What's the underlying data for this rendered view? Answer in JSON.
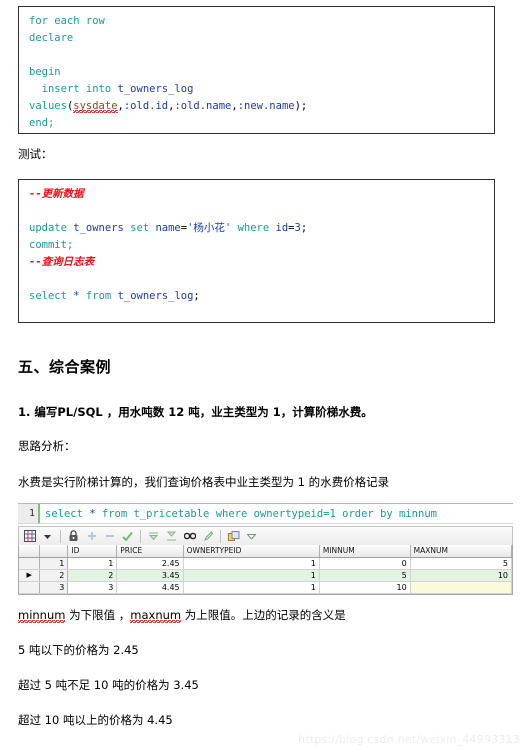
{
  "code_block_1": {
    "name": "trigger-body-code",
    "lines": [
      [
        {
          "t": "for each row",
          "c": "kw"
        }
      ],
      [
        {
          "t": "declare",
          "c": "kw"
        }
      ],
      [
        {
          "t": "",
          "c": "plain"
        }
      ],
      [
        {
          "t": "begin",
          "c": "kw"
        }
      ],
      [
        {
          "t": "  ",
          "c": "plain"
        },
        {
          "t": "insert into",
          "c": "kw"
        },
        {
          "t": " ",
          "c": "plain"
        },
        {
          "t": "t_owners_log",
          "c": "tbl"
        }
      ],
      [
        {
          "t": "values",
          "c": "fn"
        },
        {
          "t": "(",
          "c": "plain"
        },
        {
          "t": "sysdate",
          "c": "sq"
        },
        {
          "t": ",",
          "c": "plain"
        },
        {
          "t": ":old.id",
          "c": "bind"
        },
        {
          "t": ",",
          "c": "plain"
        },
        {
          "t": ":old.name",
          "c": "bind"
        },
        {
          "t": ",",
          "c": "plain"
        },
        {
          "t": ":new.name",
          "c": "bind"
        },
        {
          "t": ");",
          "c": "plain"
        }
      ],
      [
        {
          "t": "end;",
          "c": "kw"
        }
      ]
    ]
  },
  "label_test": "测试：",
  "code_block_2": {
    "name": "test-sql-code",
    "lines": [
      [
        {
          "t": "--更新数据",
          "c": "cmt"
        }
      ],
      [
        {
          "t": "",
          "c": "plain"
        }
      ],
      [
        {
          "t": "update",
          "c": "kw"
        },
        {
          "t": " ",
          "c": "plain"
        },
        {
          "t": "t_owners",
          "c": "tbl"
        },
        {
          "t": " ",
          "c": "plain"
        },
        {
          "t": "set",
          "c": "kw"
        },
        {
          "t": " ",
          "c": "plain"
        },
        {
          "t": "name",
          "c": "tbl"
        },
        {
          "t": "=",
          "c": "plain"
        },
        {
          "t": "'杨小花'",
          "c": "str"
        },
        {
          "t": " ",
          "c": "plain"
        },
        {
          "t": "where",
          "c": "kw"
        },
        {
          "t": " ",
          "c": "plain"
        },
        {
          "t": "id",
          "c": "tbl"
        },
        {
          "t": "=",
          "c": "plain"
        },
        {
          "t": "3",
          "c": "num"
        },
        {
          "t": ";",
          "c": "plain"
        }
      ],
      [
        {
          "t": "commit;",
          "c": "kw"
        }
      ],
      [
        {
          "t": "--查询日志表",
          "c": "cmt"
        }
      ],
      [
        {
          "t": "",
          "c": "plain"
        }
      ],
      [
        {
          "t": "select",
          "c": "kw"
        },
        {
          "t": " ",
          "c": "plain"
        },
        {
          "t": "*",
          "c": "str"
        },
        {
          "t": " ",
          "c": "plain"
        },
        {
          "t": "from",
          "c": "kw"
        },
        {
          "t": " ",
          "c": "plain"
        },
        {
          "t": "t_owners_log",
          "c": "tbl"
        },
        {
          "t": ";",
          "c": "plain"
        }
      ]
    ]
  },
  "section_heading": "五、综合案例",
  "task_line": "1. 编写PL/SQL ，用水吨数 12 吨，业主类型为 1，计算阶梯水费。",
  "label_analysis": "思路分析：",
  "paragraph_intro": "水费是实行阶梯计算的，我们查询价格表中业主类型为 1 的水费价格记录",
  "sql_editor": {
    "line_number": "1",
    "query_prefix": "select ",
    "query_star": "*",
    "query_suffix": " from t_pricetable where ownertypeid=1 order by minnum"
  },
  "grid_toolbar": {
    "icons": [
      {
        "name": "grid-view-icon",
        "glyph": "grid"
      },
      {
        "name": "dropdown-arrow-icon",
        "glyph": "caret"
      },
      {
        "name": "lock-icon",
        "glyph": "lock"
      },
      {
        "name": "add-record-icon",
        "glyph": "plus"
      },
      {
        "name": "remove-record-icon",
        "glyph": "minus"
      },
      {
        "name": "commit-check-icon",
        "glyph": "check"
      },
      {
        "name": "export-down-icon",
        "glyph": "dn1"
      },
      {
        "name": "export-bottom-icon",
        "glyph": "dn2"
      },
      {
        "name": "find-binoculars-icon",
        "glyph": "find"
      },
      {
        "name": "clear-filter-icon",
        "glyph": "brush"
      },
      {
        "name": "copy-data-icon",
        "glyph": "copy"
      },
      {
        "name": "more-arrow-icon",
        "glyph": "caret2"
      }
    ]
  },
  "result_grid": {
    "columns": [
      "ID",
      "PRICE",
      "OWNERTYPEID",
      "MINNUM",
      "MAXNUM"
    ],
    "rows": [
      {
        "marker": "",
        "num": "1",
        "ID": "1",
        "PRICE": "2.45",
        "OWNERTYPEID": "1",
        "MINNUM": "0",
        "MAXNUM": "5",
        "selected": false,
        "maxnum_null": false
      },
      {
        "marker": "▶",
        "num": "2",
        "ID": "2",
        "PRICE": "3.45",
        "OWNERTYPEID": "1",
        "MINNUM": "5",
        "MAXNUM": "10",
        "selected": true,
        "maxnum_null": false
      },
      {
        "marker": "",
        "num": "3",
        "ID": "3",
        "PRICE": "4.45",
        "OWNERTYPEID": "1",
        "MINNUM": "10",
        "MAXNUM": "",
        "selected": false,
        "maxnum_null": true
      }
    ]
  },
  "paragraph_minmax": {
    "part1": "minnum",
    "part2": " 为下限值 ，",
    "part3": "maxnum",
    "part4": " 为上限值。上边的记录的含义是"
  },
  "paragraph_rule1": "5 吨以下的价格为 2.45",
  "paragraph_rule2": "超过 5 吨不足 10 吨的价格为 3.45",
  "paragraph_rule3": "超过 10 吨以上的价格为 4.45",
  "watermark": "https://blog.csdn.net/weixin_44993313",
  "colors": {
    "keyword": "#1a9a9a",
    "table": "#1d3ba8",
    "comment": "#e8131b",
    "string": "#1540d0",
    "selected_row": "#e2f3e2",
    "null_cell": "#fbfbdc"
  }
}
